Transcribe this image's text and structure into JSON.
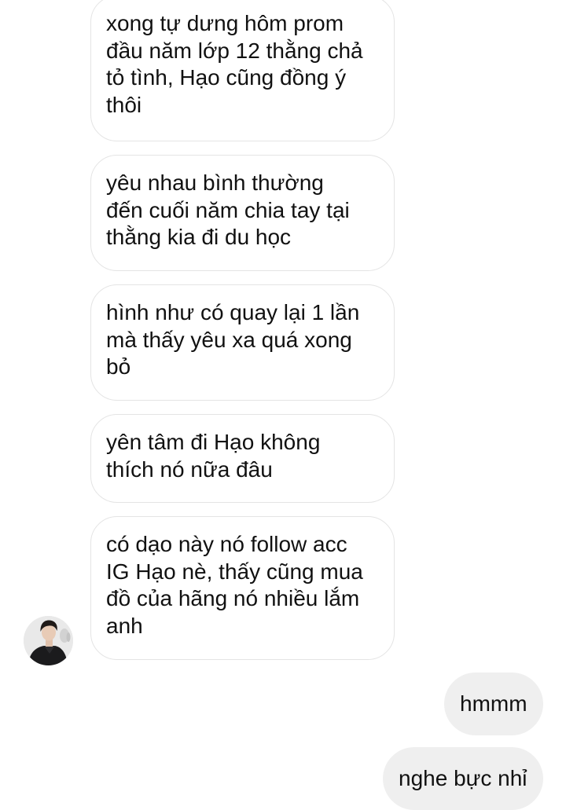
{
  "conversation": {
    "incoming_messages": [
      "xong tự dưng hôm prom\nđầu năm lớp 12 thằng chả\ntỏ tình, Hạo cũng đồng ý\nthôi",
      "yêu nhau bình thường\nđến cuối năm chia tay tại\nthằng kia đi du học",
      "hình như có quay lại 1 lần\nmà thấy yêu xa quá xong\nbỏ",
      "yên tâm đi Hạo không\nthích nó nữa đâu",
      "có dạo này nó follow acc\nIG Hạo nè, thấy cũng mua\nđồ của hãng nó nhiều lắm\nanh"
    ],
    "outgoing_messages": [
      "hmmm",
      "nghe bực nhỉ"
    ]
  },
  "colors": {
    "incoming_bubble_border": "#e4e4e4",
    "outgoing_bubble_bg": "#efefef",
    "text": "#111111"
  }
}
